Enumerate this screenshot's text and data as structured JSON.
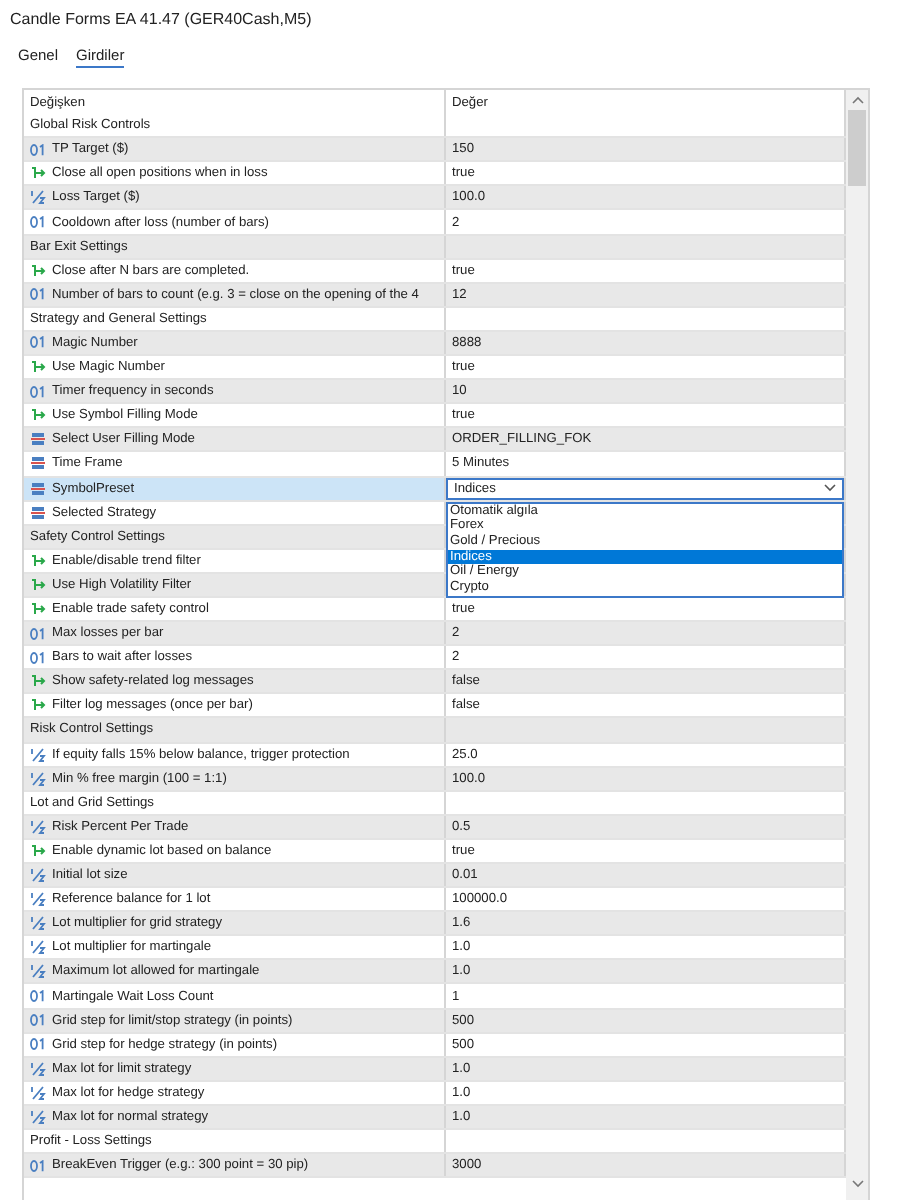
{
  "window": {
    "title": "Candle Forms EA 41.47 (GER40Cash,M5)"
  },
  "tabs": [
    {
      "label": "Genel",
      "selected": false
    },
    {
      "label": "Girdiler",
      "selected": true
    }
  ],
  "table": {
    "columns": [
      "Değişken",
      "Değer"
    ],
    "rows": [
      {
        "kind": "section",
        "name": "Global Risk Controls",
        "selected": false
      },
      {
        "kind": "int",
        "name": "TP Target ($)",
        "value": "150",
        "selected": false
      },
      {
        "kind": "bool",
        "name": "Close all open positions when in loss",
        "value": "true",
        "selected": false
      },
      {
        "kind": "double",
        "name": "Loss Target ($)",
        "value": "100.0",
        "selected": false
      },
      {
        "kind": "int",
        "name": "Cooldown after loss (number of bars)",
        "value": "2",
        "selected": false
      },
      {
        "kind": "section",
        "name": "Bar Exit Settings",
        "selected": false
      },
      {
        "kind": "bool",
        "name": "Close after N bars are completed.",
        "value": "true",
        "selected": false
      },
      {
        "kind": "int",
        "name": "Number of bars to count (e.g. 3 = close on the opening of the 4",
        "value": "12",
        "selected": false
      },
      {
        "kind": "section",
        "name": "Strategy and General Settings",
        "selected": false
      },
      {
        "kind": "int",
        "name": "Magic Number",
        "value": "8888",
        "selected": false
      },
      {
        "kind": "bool",
        "name": "Use Magic Number",
        "value": "true",
        "selected": false
      },
      {
        "kind": "int",
        "name": "Timer frequency in seconds",
        "value": "10",
        "selected": false
      },
      {
        "kind": "bool",
        "name": "Use Symbol Filling Mode",
        "value": "true",
        "selected": false
      },
      {
        "kind": "enum",
        "name": "Select User Filling Mode",
        "value": "ORDER_FILLING_FOK",
        "selected": false
      },
      {
        "kind": "enum",
        "name": "Time Frame",
        "value": "5 Minutes",
        "selected": false
      },
      {
        "kind": "enum",
        "name": "SymbolPreset",
        "value": "Indices",
        "selected": true,
        "dropdown": [
          {
            "label": "Otomatik algıla",
            "selected": false
          },
          {
            "label": "Forex",
            "selected": false
          },
          {
            "label": "Gold / Precious",
            "selected": false
          },
          {
            "label": "Indices",
            "selected": true
          },
          {
            "label": "Oil / Energy",
            "selected": false
          },
          {
            "label": "Crypto",
            "selected": false
          }
        ]
      },
      {
        "kind": "enum",
        "name": "Selected Strategy",
        "selected": false
      },
      {
        "kind": "section",
        "name": "Safety Control Settings",
        "selected": false
      },
      {
        "kind": "bool",
        "name": "Enable/disable trend filter",
        "selected": false
      },
      {
        "kind": "bool",
        "name": "Use High Volatility Filter",
        "selected": false
      },
      {
        "kind": "bool",
        "name": "Enable trade safety control",
        "value": "true",
        "selected": false
      },
      {
        "kind": "int",
        "name": "Max losses per bar",
        "value": "2",
        "selected": false
      },
      {
        "kind": "int",
        "name": "Bars to wait after losses",
        "value": "2",
        "selected": false
      },
      {
        "kind": "bool",
        "name": "Show safety-related log messages",
        "value": "false",
        "selected": false
      },
      {
        "kind": "bool",
        "name": "Filter log messages (once per bar)",
        "value": "false",
        "selected": false
      },
      {
        "kind": "section",
        "name": "Risk Control Settings",
        "selected": false
      },
      {
        "kind": "double",
        "name": "If equity falls 15% below balance, trigger protection",
        "value": "25.0",
        "selected": false
      },
      {
        "kind": "double",
        "name": "Min % free margin (100 = 1:1)",
        "value": "100.0",
        "selected": false
      },
      {
        "kind": "section",
        "name": "Lot and Grid Settings",
        "selected": false
      },
      {
        "kind": "double",
        "name": "Risk Percent Per Trade",
        "value": "0.5",
        "selected": false
      },
      {
        "kind": "bool",
        "name": "Enable dynamic lot based on balance",
        "value": "true",
        "selected": false
      },
      {
        "kind": "double",
        "name": "Initial lot size",
        "value": "0.01",
        "selected": false
      },
      {
        "kind": "double",
        "name": "Reference balance for 1 lot",
        "value": "100000.0",
        "selected": false
      },
      {
        "kind": "double",
        "name": "Lot multiplier for grid strategy",
        "value": "1.6",
        "selected": false
      },
      {
        "kind": "double",
        "name": "Lot multiplier for martingale",
        "value": "1.0",
        "selected": false
      },
      {
        "kind": "double",
        "name": "Maximum lot allowed for martingale",
        "value": "1.0",
        "selected": false
      },
      {
        "kind": "int",
        "name": "Martingale Wait Loss Count",
        "value": "1",
        "selected": false
      },
      {
        "kind": "int",
        "name": "Grid step for limit/stop strategy (in points)",
        "value": "500",
        "selected": false
      },
      {
        "kind": "int",
        "name": "Grid step for hedge strategy (in points)",
        "value": "500",
        "selected": false
      },
      {
        "kind": "double",
        "name": "Max lot for limit strategy",
        "value": "1.0",
        "selected": false
      },
      {
        "kind": "double",
        "name": "Max lot for hedge strategy",
        "value": "1.0",
        "selected": false
      },
      {
        "kind": "double",
        "name": "Max lot for normal strategy",
        "value": "1.0",
        "selected": false
      },
      {
        "kind": "section",
        "name": "Profit - Loss Settings",
        "selected": false
      },
      {
        "kind": "int",
        "name": "BreakEven Trigger (e.g.: 300 point = 30 pip)",
        "value": "3000",
        "selected": false
      }
    ]
  }
}
